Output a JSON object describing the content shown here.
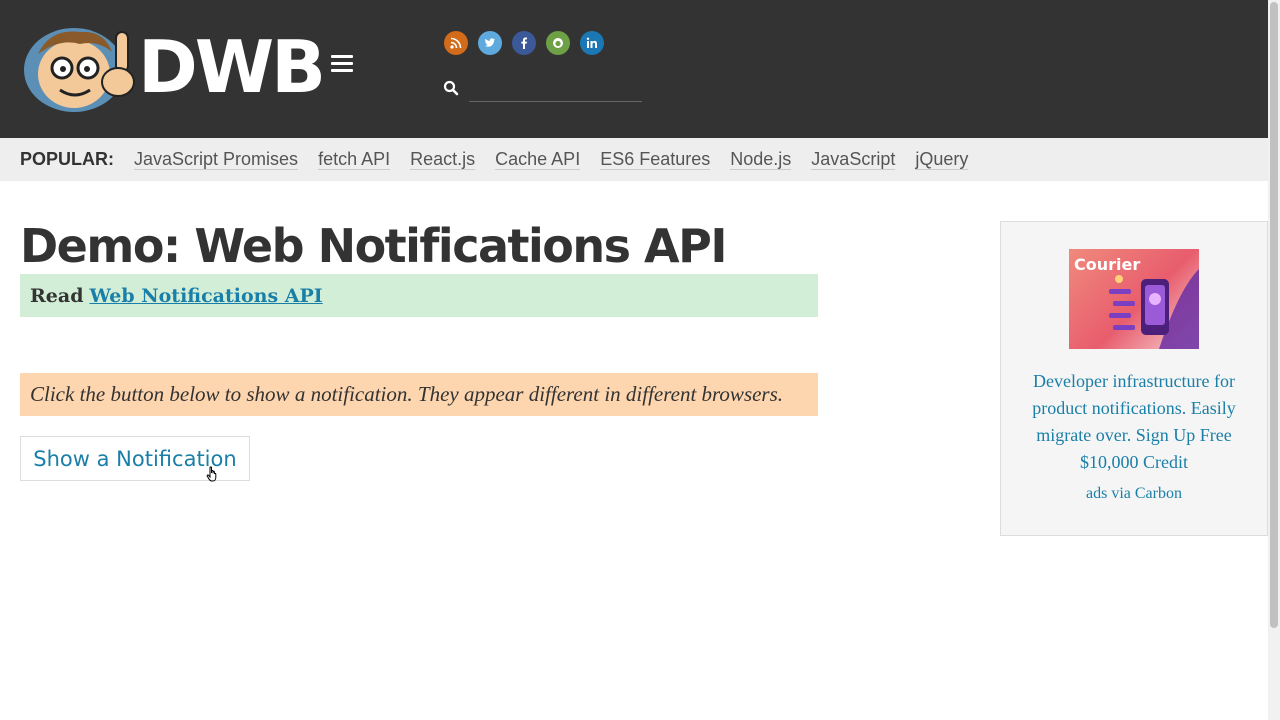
{
  "header": {
    "logo_text": "DWB",
    "search": {
      "value": "",
      "placeholder": ""
    },
    "social_icons": [
      "rss-icon",
      "twitter-icon",
      "facebook-icon",
      "github-icon",
      "linkedin-icon"
    ],
    "colors": {
      "background": "#333333",
      "rss": "#d26b1a",
      "twitter": "#5ea9dd",
      "facebook": "#3b5998",
      "github": "#6ea046",
      "linkedin": "#1b78b4"
    }
  },
  "popular": {
    "label": "POPULAR:",
    "links": [
      "JavaScript Promises",
      "fetch API",
      "React.js",
      "Cache API",
      "ES6 Features",
      "Node.js",
      "JavaScript",
      "jQuery"
    ]
  },
  "main": {
    "title": "Demo: Web Notifications API",
    "read_prefix": "Read",
    "read_link": "Web Notifications API",
    "info": "Click the button below to show a notification. They appear different in different browsers.",
    "button_label": "Show a Notification",
    "colors": {
      "read_bg": "#d3eed7",
      "info_bg": "#fdd5ae",
      "link": "#1a7fa8"
    }
  },
  "ad": {
    "brand": "Courier",
    "text": "Developer infrastructure for product notifications. Easily migrate over. Sign Up Free $10,000 Credit",
    "via": "ads via Carbon"
  }
}
